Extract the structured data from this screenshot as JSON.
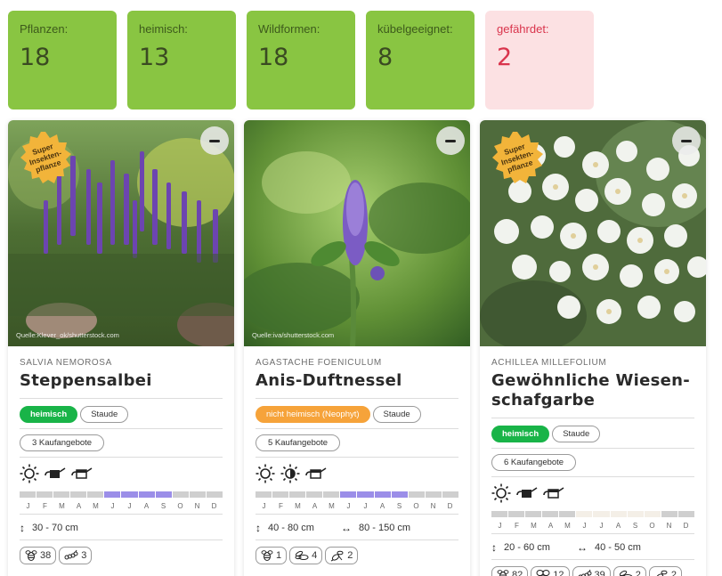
{
  "stats": [
    {
      "label": "Pflanzen:",
      "value": "18"
    },
    {
      "label": "heimisch:",
      "value": "13"
    },
    {
      "label": "Wildformen:",
      "value": "18"
    },
    {
      "label": "kübelgeeignet:",
      "value": "8"
    },
    {
      "label": "gefährdet:",
      "value": "2"
    }
  ],
  "colors": {
    "stat_green": "#89c542",
    "stat_warn": "#fce1e3",
    "native": "#19b448",
    "neophyt": "#f6a33a",
    "bloom": "#9b8ee8"
  },
  "month_letters": [
    "J",
    "F",
    "M",
    "A",
    "M",
    "J",
    "J",
    "A",
    "S",
    "O",
    "N",
    "D"
  ],
  "cards": [
    {
      "badge": "Super Insekten-pflanze",
      "credit": "Quelle:Klever_ok/shutterstock.com",
      "latin": "SALVIA NEMOROSA",
      "name": "Steppensalbei",
      "status": "heimisch",
      "type": "Staude",
      "offers": "3 Kaufangebote",
      "icons": [
        "sun-icon",
        "watering-can-icon",
        "watering-can-light-icon"
      ],
      "bloom_months": [
        6,
        7,
        8,
        9
      ],
      "height": "30 - 70 cm",
      "width": "",
      "chips": [
        {
          "icon": "bee-icon",
          "count": "38"
        },
        {
          "icon": "caterpillar-icon",
          "count": "3"
        }
      ]
    },
    {
      "badge": "",
      "credit": "Quelle:iva/shutterstock.com",
      "latin": "AGASTACHE FOENICULUM",
      "name": "Anis-Duftnessel",
      "status": "nicht heimisch (Neophyt)",
      "type": "Staude",
      "offers": "5 Kaufangebote",
      "icons": [
        "sun-icon",
        "half-shade-icon",
        "watering-can-light-icon"
      ],
      "bloom_months": [
        6,
        7,
        8,
        9
      ],
      "height": "40 - 80 cm",
      "width": "80 - 150 cm",
      "chips": [
        {
          "icon": "bee-icon",
          "count": "1"
        },
        {
          "icon": "hoverfly-icon",
          "count": "4"
        },
        {
          "icon": "wasp-icon",
          "count": "2"
        }
      ]
    },
    {
      "badge": "Super Insekten-pflanze",
      "credit": "",
      "latin": "ACHILLEA MILLEFOLIUM",
      "name": "Gewöhnliche Wiesen-schafgarbe",
      "status": "heimisch",
      "type": "Staude",
      "offers": "6 Kaufangebote",
      "icons": [
        "sun-icon",
        "watering-can-icon",
        "watering-can-light-icon"
      ],
      "bloom_months": [
        6,
        7,
        8,
        9,
        10
      ],
      "height": "20 - 60 cm",
      "width": "40 - 50 cm",
      "chips": [
        {
          "icon": "bee-icon",
          "count": "82"
        },
        {
          "icon": "butterfly-icon",
          "count": "12"
        },
        {
          "icon": "caterpillar-icon",
          "count": "39"
        },
        {
          "icon": "hoverfly-icon",
          "count": "2"
        },
        {
          "icon": "wasp-icon",
          "count": "2"
        }
      ]
    }
  ]
}
